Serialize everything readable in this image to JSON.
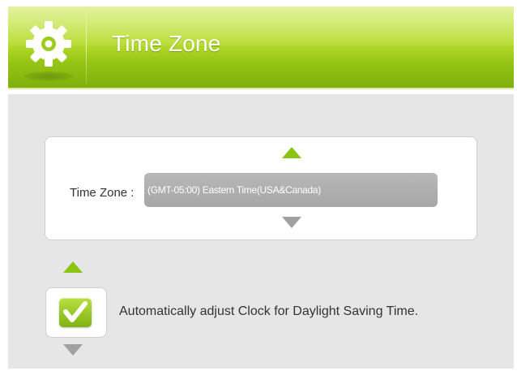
{
  "header": {
    "title": "Time Zone",
    "icon": "gear-icon",
    "accent_color": "#96c414"
  },
  "time_zone": {
    "label": "Time Zone :",
    "selected_value": "(GMT-05:00) Eastern  Time(USA&Canada)",
    "prev_icon": "arrow-up-icon",
    "next_icon": "arrow-down-icon"
  },
  "daylight_saving": {
    "label": "Automatically adjust Clock for Daylight Saving Time.",
    "checked": true,
    "prev_icon": "arrow-up-icon",
    "next_icon": "arrow-down-icon"
  }
}
